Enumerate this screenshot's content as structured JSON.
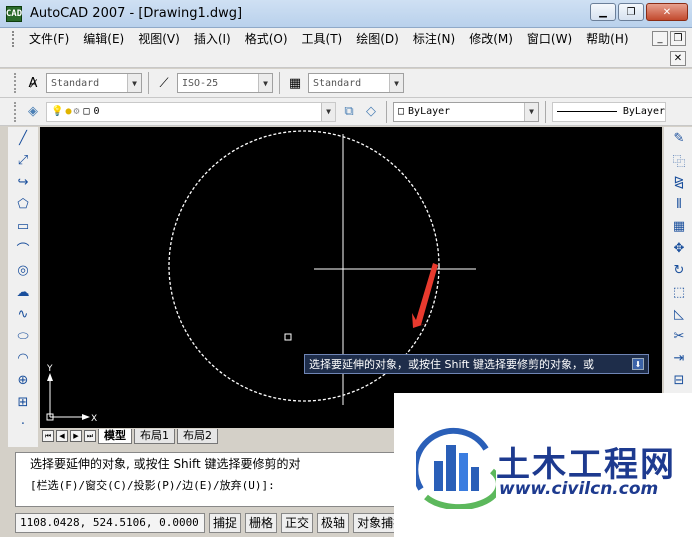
{
  "window": {
    "title": "AutoCAD 2007 - [Drawing1.dwg]",
    "app_icon_text": "CAD"
  },
  "menu": [
    "文件(F)",
    "编辑(E)",
    "视图(V)",
    "插入(I)",
    "格式(O)",
    "工具(T)",
    "绘图(D)",
    "标注(N)",
    "修改(M)",
    "窗口(W)",
    "帮助(H)"
  ],
  "toolbar_styles": {
    "text_style": "Standard",
    "dim_style": "ISO-25",
    "table_style": "Standard"
  },
  "toolbar_layers": {
    "layer_name": "0",
    "color": "ByLayer",
    "linetype": "ByLayer"
  },
  "drawing": {
    "tooltip": "选择要延伸的对象，或按住 Shift 键选择要修剪的对象，或",
    "ucs_x": "X",
    "ucs_y": "Y",
    "circle_color": "#ffffff",
    "arrow_color": "#e83a2e"
  },
  "layout_tabs": [
    "模型",
    "布局1",
    "布局2"
  ],
  "command": {
    "line1": "选择要延伸的对象, 或按住 Shift 键选择要修剪的对",
    "line2": "[栏选(F)/窗交(C)/投影(P)/边(E)/放弃(U)]:"
  },
  "status": {
    "coords": "1108.0428, 524.5106, 0.0000",
    "buttons": [
      "捕捉",
      "栅格",
      "正交",
      "极轴",
      "对象捕捉"
    ]
  },
  "watermark": {
    "title": "土木工程网",
    "url": "www.civilcn.com"
  }
}
